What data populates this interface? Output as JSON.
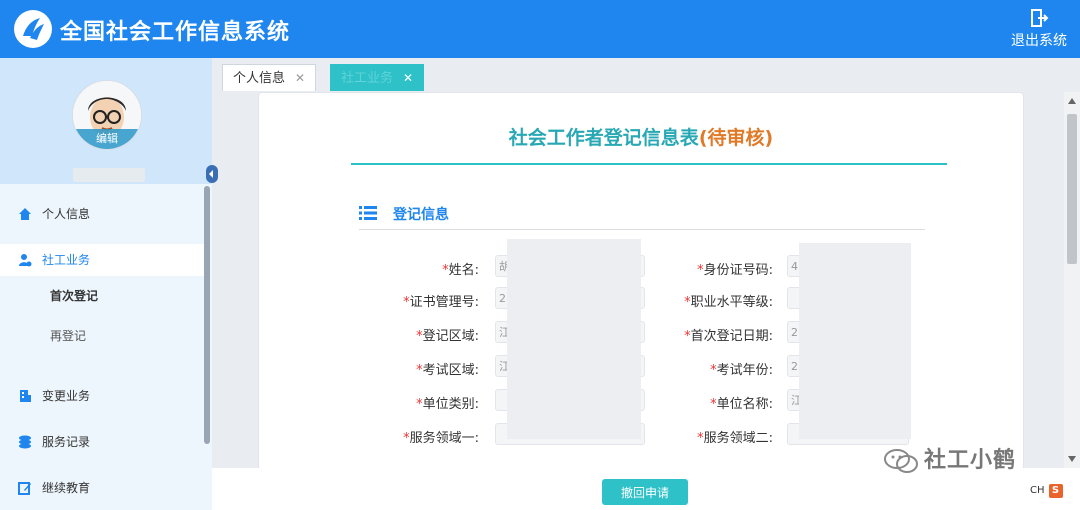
{
  "header": {
    "title": "全国社会工作信息系统",
    "logout_label": "退出系统"
  },
  "sidebar": {
    "avatar_edit": "编辑",
    "menu": [
      {
        "label": "个人信息",
        "icon": "home-icon"
      },
      {
        "label": "社工业务",
        "icon": "user-icon",
        "active": true
      },
      {
        "label": "变更业务",
        "icon": "building-icon"
      },
      {
        "label": "服务记录",
        "icon": "layers-icon"
      },
      {
        "label": "继续教育",
        "icon": "edit-icon"
      }
    ],
    "submenu": [
      {
        "label": "首次登记",
        "current": true
      },
      {
        "label": "再登记"
      }
    ]
  },
  "tabs": [
    {
      "label": "个人信息"
    },
    {
      "label": "社工业务",
      "active": true
    }
  ],
  "form": {
    "title": "社会工作者登记信息表",
    "status": "(待审核)",
    "section_title": "登记信息",
    "fields_left": [
      {
        "label": "姓名:",
        "value": "胡"
      },
      {
        "label": "证书管理号:",
        "value": "2"
      },
      {
        "label": "登记区域:",
        "value": "江"
      },
      {
        "label": "考试区域:",
        "value": "江"
      },
      {
        "label": "单位类别:",
        "value": ""
      },
      {
        "label": "服务领域一:",
        "value": ""
      }
    ],
    "fields_right": [
      {
        "label": "身份证号码:",
        "value": "4"
      },
      {
        "label": "职业水平等级:",
        "value": ""
      },
      {
        "label": "首次登记日期:",
        "value": "2"
      },
      {
        "label": "考试年份:",
        "value": "2"
      },
      {
        "label": "单位名称:",
        "value": "江"
      },
      {
        "label": "服务领域二:",
        "value": ""
      }
    ]
  },
  "footer": {
    "withdraw_label": "撤回申请",
    "watermark": "社工小鹤",
    "ime_label": "CH",
    "ime_logo": "S"
  },
  "colors": {
    "header_bg": "#1e86ee",
    "accent_teal": "#2ec1c8",
    "status_orange": "#e07a28",
    "required_red": "#e33"
  }
}
